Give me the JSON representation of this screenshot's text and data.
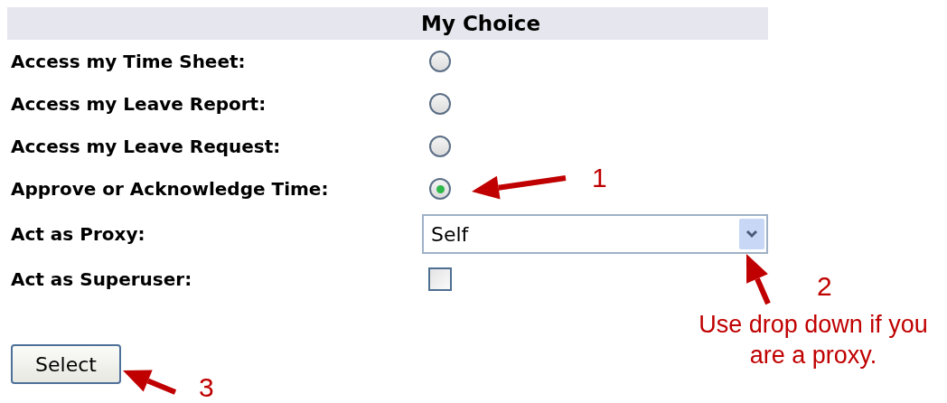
{
  "header": {
    "column_2": "My Choice"
  },
  "rows": [
    {
      "label": "Access my Time Sheet:",
      "kind": "radio",
      "selected": false
    },
    {
      "label": "Access my Leave Report:",
      "kind": "radio",
      "selected": false
    },
    {
      "label": "Access my Leave Request:",
      "kind": "radio",
      "selected": false
    },
    {
      "label": "Approve or Acknowledge Time:",
      "kind": "radio",
      "selected": true
    },
    {
      "label": "Act as Proxy:",
      "kind": "select",
      "value": "Self"
    },
    {
      "label": "Act as Superuser:",
      "kind": "checkbox",
      "checked": false
    }
  ],
  "button": "Select",
  "annotations": [
    {
      "number": "1"
    },
    {
      "number": "2",
      "note": "Use drop down if you are a proxy."
    },
    {
      "number": "3"
    }
  ]
}
